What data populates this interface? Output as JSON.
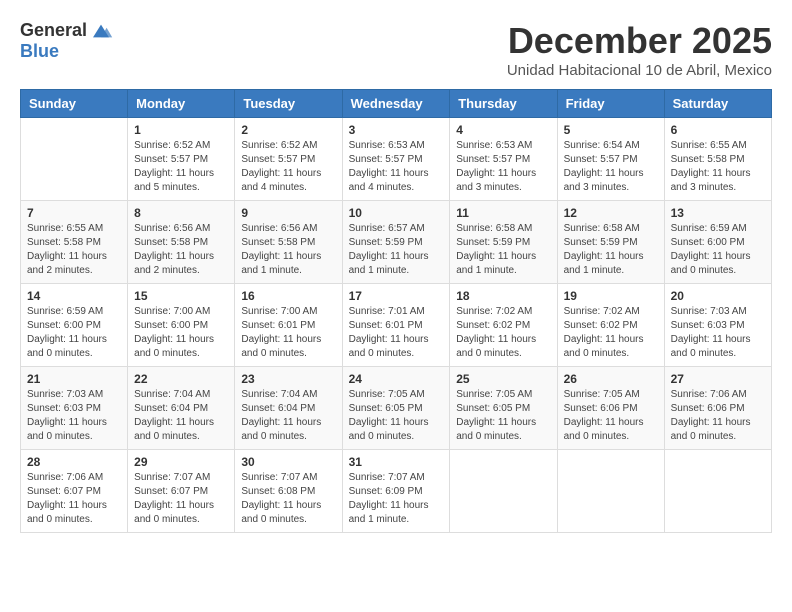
{
  "logo": {
    "general": "General",
    "blue": "Blue"
  },
  "title": "December 2025",
  "subtitle": "Unidad Habitacional 10 de Abril, Mexico",
  "days_of_week": [
    "Sunday",
    "Monday",
    "Tuesday",
    "Wednesday",
    "Thursday",
    "Friday",
    "Saturday"
  ],
  "weeks": [
    [
      {
        "day": "",
        "info": ""
      },
      {
        "day": "1",
        "info": "Sunrise: 6:52 AM\nSunset: 5:57 PM\nDaylight: 11 hours\nand 5 minutes."
      },
      {
        "day": "2",
        "info": "Sunrise: 6:52 AM\nSunset: 5:57 PM\nDaylight: 11 hours\nand 4 minutes."
      },
      {
        "day": "3",
        "info": "Sunrise: 6:53 AM\nSunset: 5:57 PM\nDaylight: 11 hours\nand 4 minutes."
      },
      {
        "day": "4",
        "info": "Sunrise: 6:53 AM\nSunset: 5:57 PM\nDaylight: 11 hours\nand 3 minutes."
      },
      {
        "day": "5",
        "info": "Sunrise: 6:54 AM\nSunset: 5:57 PM\nDaylight: 11 hours\nand 3 minutes."
      },
      {
        "day": "6",
        "info": "Sunrise: 6:55 AM\nSunset: 5:58 PM\nDaylight: 11 hours\nand 3 minutes."
      }
    ],
    [
      {
        "day": "7",
        "info": "Sunrise: 6:55 AM\nSunset: 5:58 PM\nDaylight: 11 hours\nand 2 minutes."
      },
      {
        "day": "8",
        "info": "Sunrise: 6:56 AM\nSunset: 5:58 PM\nDaylight: 11 hours\nand 2 minutes."
      },
      {
        "day": "9",
        "info": "Sunrise: 6:56 AM\nSunset: 5:58 PM\nDaylight: 11 hours\nand 1 minute."
      },
      {
        "day": "10",
        "info": "Sunrise: 6:57 AM\nSunset: 5:59 PM\nDaylight: 11 hours\nand 1 minute."
      },
      {
        "day": "11",
        "info": "Sunrise: 6:58 AM\nSunset: 5:59 PM\nDaylight: 11 hours\nand 1 minute."
      },
      {
        "day": "12",
        "info": "Sunrise: 6:58 AM\nSunset: 5:59 PM\nDaylight: 11 hours\nand 1 minute."
      },
      {
        "day": "13",
        "info": "Sunrise: 6:59 AM\nSunset: 6:00 PM\nDaylight: 11 hours\nand 0 minutes."
      }
    ],
    [
      {
        "day": "14",
        "info": "Sunrise: 6:59 AM\nSunset: 6:00 PM\nDaylight: 11 hours\nand 0 minutes."
      },
      {
        "day": "15",
        "info": "Sunrise: 7:00 AM\nSunset: 6:00 PM\nDaylight: 11 hours\nand 0 minutes."
      },
      {
        "day": "16",
        "info": "Sunrise: 7:00 AM\nSunset: 6:01 PM\nDaylight: 11 hours\nand 0 minutes."
      },
      {
        "day": "17",
        "info": "Sunrise: 7:01 AM\nSunset: 6:01 PM\nDaylight: 11 hours\nand 0 minutes."
      },
      {
        "day": "18",
        "info": "Sunrise: 7:02 AM\nSunset: 6:02 PM\nDaylight: 11 hours\nand 0 minutes."
      },
      {
        "day": "19",
        "info": "Sunrise: 7:02 AM\nSunset: 6:02 PM\nDaylight: 11 hours\nand 0 minutes."
      },
      {
        "day": "20",
        "info": "Sunrise: 7:03 AM\nSunset: 6:03 PM\nDaylight: 11 hours\nand 0 minutes."
      }
    ],
    [
      {
        "day": "21",
        "info": "Sunrise: 7:03 AM\nSunset: 6:03 PM\nDaylight: 11 hours\nand 0 minutes."
      },
      {
        "day": "22",
        "info": "Sunrise: 7:04 AM\nSunset: 6:04 PM\nDaylight: 11 hours\nand 0 minutes."
      },
      {
        "day": "23",
        "info": "Sunrise: 7:04 AM\nSunset: 6:04 PM\nDaylight: 11 hours\nand 0 minutes."
      },
      {
        "day": "24",
        "info": "Sunrise: 7:05 AM\nSunset: 6:05 PM\nDaylight: 11 hours\nand 0 minutes."
      },
      {
        "day": "25",
        "info": "Sunrise: 7:05 AM\nSunset: 6:05 PM\nDaylight: 11 hours\nand 0 minutes."
      },
      {
        "day": "26",
        "info": "Sunrise: 7:05 AM\nSunset: 6:06 PM\nDaylight: 11 hours\nand 0 minutes."
      },
      {
        "day": "27",
        "info": "Sunrise: 7:06 AM\nSunset: 6:06 PM\nDaylight: 11 hours\nand 0 minutes."
      }
    ],
    [
      {
        "day": "28",
        "info": "Sunrise: 7:06 AM\nSunset: 6:07 PM\nDaylight: 11 hours\nand 0 minutes."
      },
      {
        "day": "29",
        "info": "Sunrise: 7:07 AM\nSunset: 6:07 PM\nDaylight: 11 hours\nand 0 minutes."
      },
      {
        "day": "30",
        "info": "Sunrise: 7:07 AM\nSunset: 6:08 PM\nDaylight: 11 hours\nand 0 minutes."
      },
      {
        "day": "31",
        "info": "Sunrise: 7:07 AM\nSunset: 6:09 PM\nDaylight: 11 hours\nand 1 minute."
      },
      {
        "day": "",
        "info": ""
      },
      {
        "day": "",
        "info": ""
      },
      {
        "day": "",
        "info": ""
      }
    ]
  ]
}
